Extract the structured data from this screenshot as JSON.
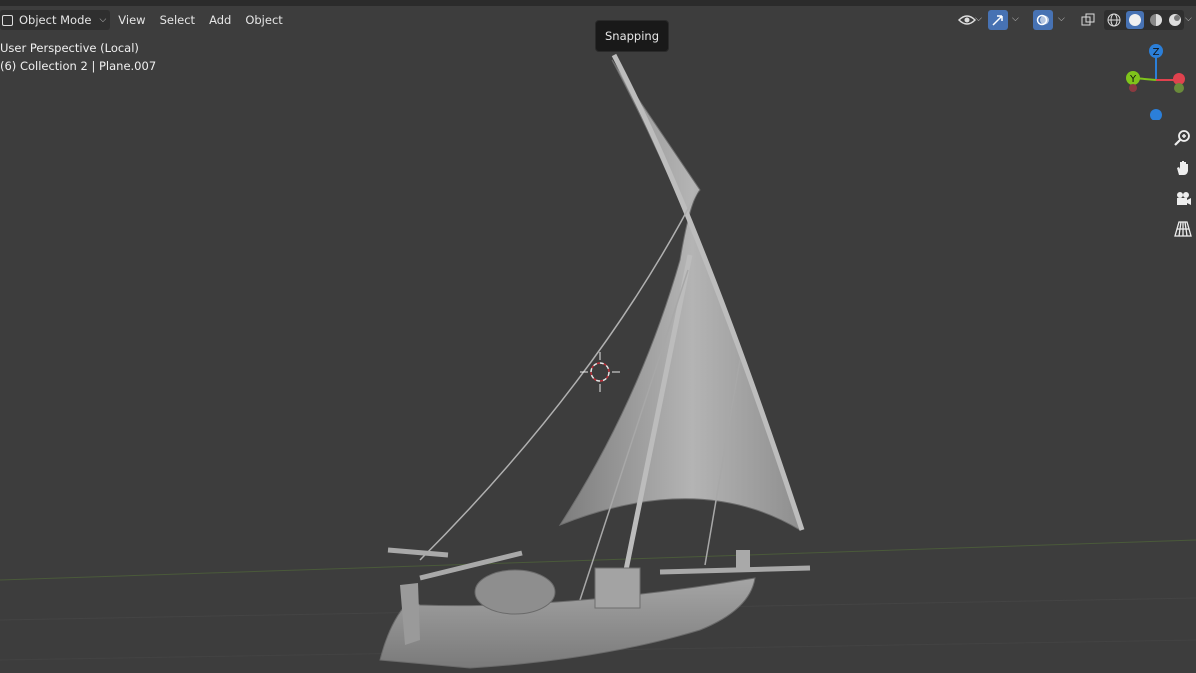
{
  "header": {
    "mode_label": "Object Mode",
    "menu": [
      "View",
      "Select",
      "Add",
      "Object"
    ]
  },
  "overlay": {
    "view_name": "User Perspective (Local)",
    "collection_info": "(6) Collection 2 | Plane.007"
  },
  "tooltip": {
    "text": "Snapping"
  },
  "gizmo": {
    "z": "Z",
    "y": "Y"
  },
  "colors": {
    "viewport_bg": "#3d3d3d",
    "axis_x": "#e0424e",
    "axis_y": "#7fc41b",
    "axis_z": "#2b7fd9",
    "active_button": "#4772b3"
  },
  "icons": [
    "visibility-icon",
    "gizmo-toggle-icon",
    "overlay-icon",
    "xray-icon",
    "wireframe-shading-icon",
    "solid-shading-icon",
    "material-shading-icon",
    "rendered-shading-icon",
    "zoom-icon",
    "pan-hand-icon",
    "camera-icon",
    "grid-icon",
    "3d-cursor-icon"
  ]
}
